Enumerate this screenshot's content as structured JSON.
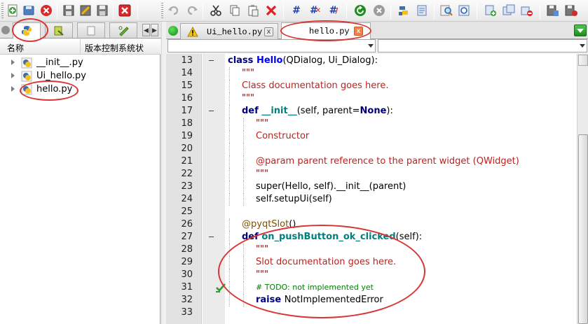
{
  "toolbar": {
    "icons": [
      "new-file-icon",
      "save-icon",
      "close-all-icon",
      "save-as-icon",
      "save-all-icon",
      "print-icon",
      "exit-icon",
      "undo-icon",
      "redo-icon",
      "cut-icon",
      "copy-icon",
      "paste-icon",
      "delete-icon",
      "comment-icon",
      "uncomment-icon",
      "toggle-comment-icon",
      "reload-icon",
      "stop-icon",
      "python-run-icon",
      "debug-icon",
      "search-icon",
      "replace-icon",
      "add-file-icon",
      "add-form-icon",
      "remove-file-icon",
      "project-props-icon",
      "project-save-icon"
    ]
  },
  "left_pane": {
    "tabs": [
      "python-tab",
      "forms-tab",
      "resources-tab",
      "interfaces-tab"
    ],
    "columns": [
      "名称",
      "版本控制系统状"
    ],
    "files": [
      {
        "name": "__init__.py"
      },
      {
        "name": "Ui_hello.py"
      },
      {
        "name": "hello.py"
      }
    ]
  },
  "editor_tabs": [
    {
      "label": "Ui_hello.py",
      "close": "x",
      "state": "warning"
    },
    {
      "label": "hello.py",
      "close": "x",
      "state": "active"
    }
  ],
  "editor": {
    "lines": [
      {
        "n": "13",
        "fold": true,
        "indent": 0,
        "parts": [
          [
            "kw",
            "class "
          ],
          [
            "cls",
            "Hello"
          ],
          [
            "pl",
            "(QDialog, Ui_Dialog):"
          ]
        ]
      },
      {
        "n": "14",
        "fold": false,
        "indent": 1,
        "parts": [
          [
            "str",
            "\"\"\""
          ]
        ]
      },
      {
        "n": "15",
        "fold": false,
        "indent": 1,
        "parts": [
          [
            "doc",
            "Class documentation goes here."
          ]
        ]
      },
      {
        "n": "16",
        "fold": false,
        "indent": 1,
        "parts": [
          [
            "str",
            "\"\"\""
          ]
        ]
      },
      {
        "n": "17",
        "fold": true,
        "indent": 1,
        "parts": [
          [
            "kw",
            "def "
          ],
          [
            "fn",
            "__init__"
          ],
          [
            "pl",
            "(self, parent="
          ],
          [
            "kw",
            "None"
          ],
          [
            "pl",
            "):"
          ]
        ]
      },
      {
        "n": "18",
        "fold": false,
        "indent": 2,
        "parts": [
          [
            "str",
            "\"\"\""
          ]
        ]
      },
      {
        "n": "19",
        "fold": false,
        "indent": 2,
        "parts": [
          [
            "doc",
            "Constructor"
          ]
        ]
      },
      {
        "n": "20",
        "fold": false,
        "indent": 2,
        "parts": []
      },
      {
        "n": "21",
        "fold": false,
        "indent": 2,
        "parts": [
          [
            "doc",
            "@param parent reference to the parent widget (QWidget)"
          ]
        ]
      },
      {
        "n": "22",
        "fold": false,
        "indent": 2,
        "parts": [
          [
            "str",
            "\"\"\""
          ]
        ]
      },
      {
        "n": "23",
        "fold": false,
        "indent": 2,
        "parts": [
          [
            "pl",
            "super(Hello, self).__init__(parent)"
          ]
        ]
      },
      {
        "n": "24",
        "fold": false,
        "indent": 2,
        "parts": [
          [
            "pl",
            "self.setupUi(self)"
          ]
        ]
      },
      {
        "n": "25",
        "fold": false,
        "indent": 0,
        "parts": []
      },
      {
        "n": "26",
        "fold": false,
        "indent": 1,
        "parts": [
          [
            "deco",
            "@pyqtSlot"
          ],
          [
            "pl",
            "()"
          ]
        ]
      },
      {
        "n": "27",
        "fold": true,
        "indent": 1,
        "parts": [
          [
            "kw",
            "def "
          ],
          [
            "fn",
            "on_pushButton_ok_clicked"
          ],
          [
            "pl",
            "(self):"
          ]
        ]
      },
      {
        "n": "28",
        "fold": false,
        "indent": 2,
        "parts": [
          [
            "str",
            "\"\"\""
          ]
        ]
      },
      {
        "n": "29",
        "fold": false,
        "indent": 2,
        "parts": [
          [
            "doc",
            "Slot documentation goes here."
          ]
        ]
      },
      {
        "n": "30",
        "fold": false,
        "indent": 2,
        "parts": [
          [
            "str",
            "\"\"\""
          ]
        ]
      },
      {
        "n": "31",
        "fold": false,
        "indent": 2,
        "parts": [
          [
            "com",
            "# TODO: not implemented yet"
          ]
        ],
        "marker": "task-check-icon"
      },
      {
        "n": "32",
        "fold": false,
        "indent": 2,
        "parts": [
          [
            "kw",
            "raise "
          ],
          [
            "pl",
            "NotImplementedError"
          ]
        ]
      },
      {
        "n": "33",
        "fold": false,
        "indent": 0,
        "parts": []
      }
    ]
  },
  "colors": {
    "annotation_red": "#d93535",
    "keyword": "#00007f",
    "classname": "#0000ff",
    "docstring": "#c0201e",
    "comment": "#007f00"
  }
}
